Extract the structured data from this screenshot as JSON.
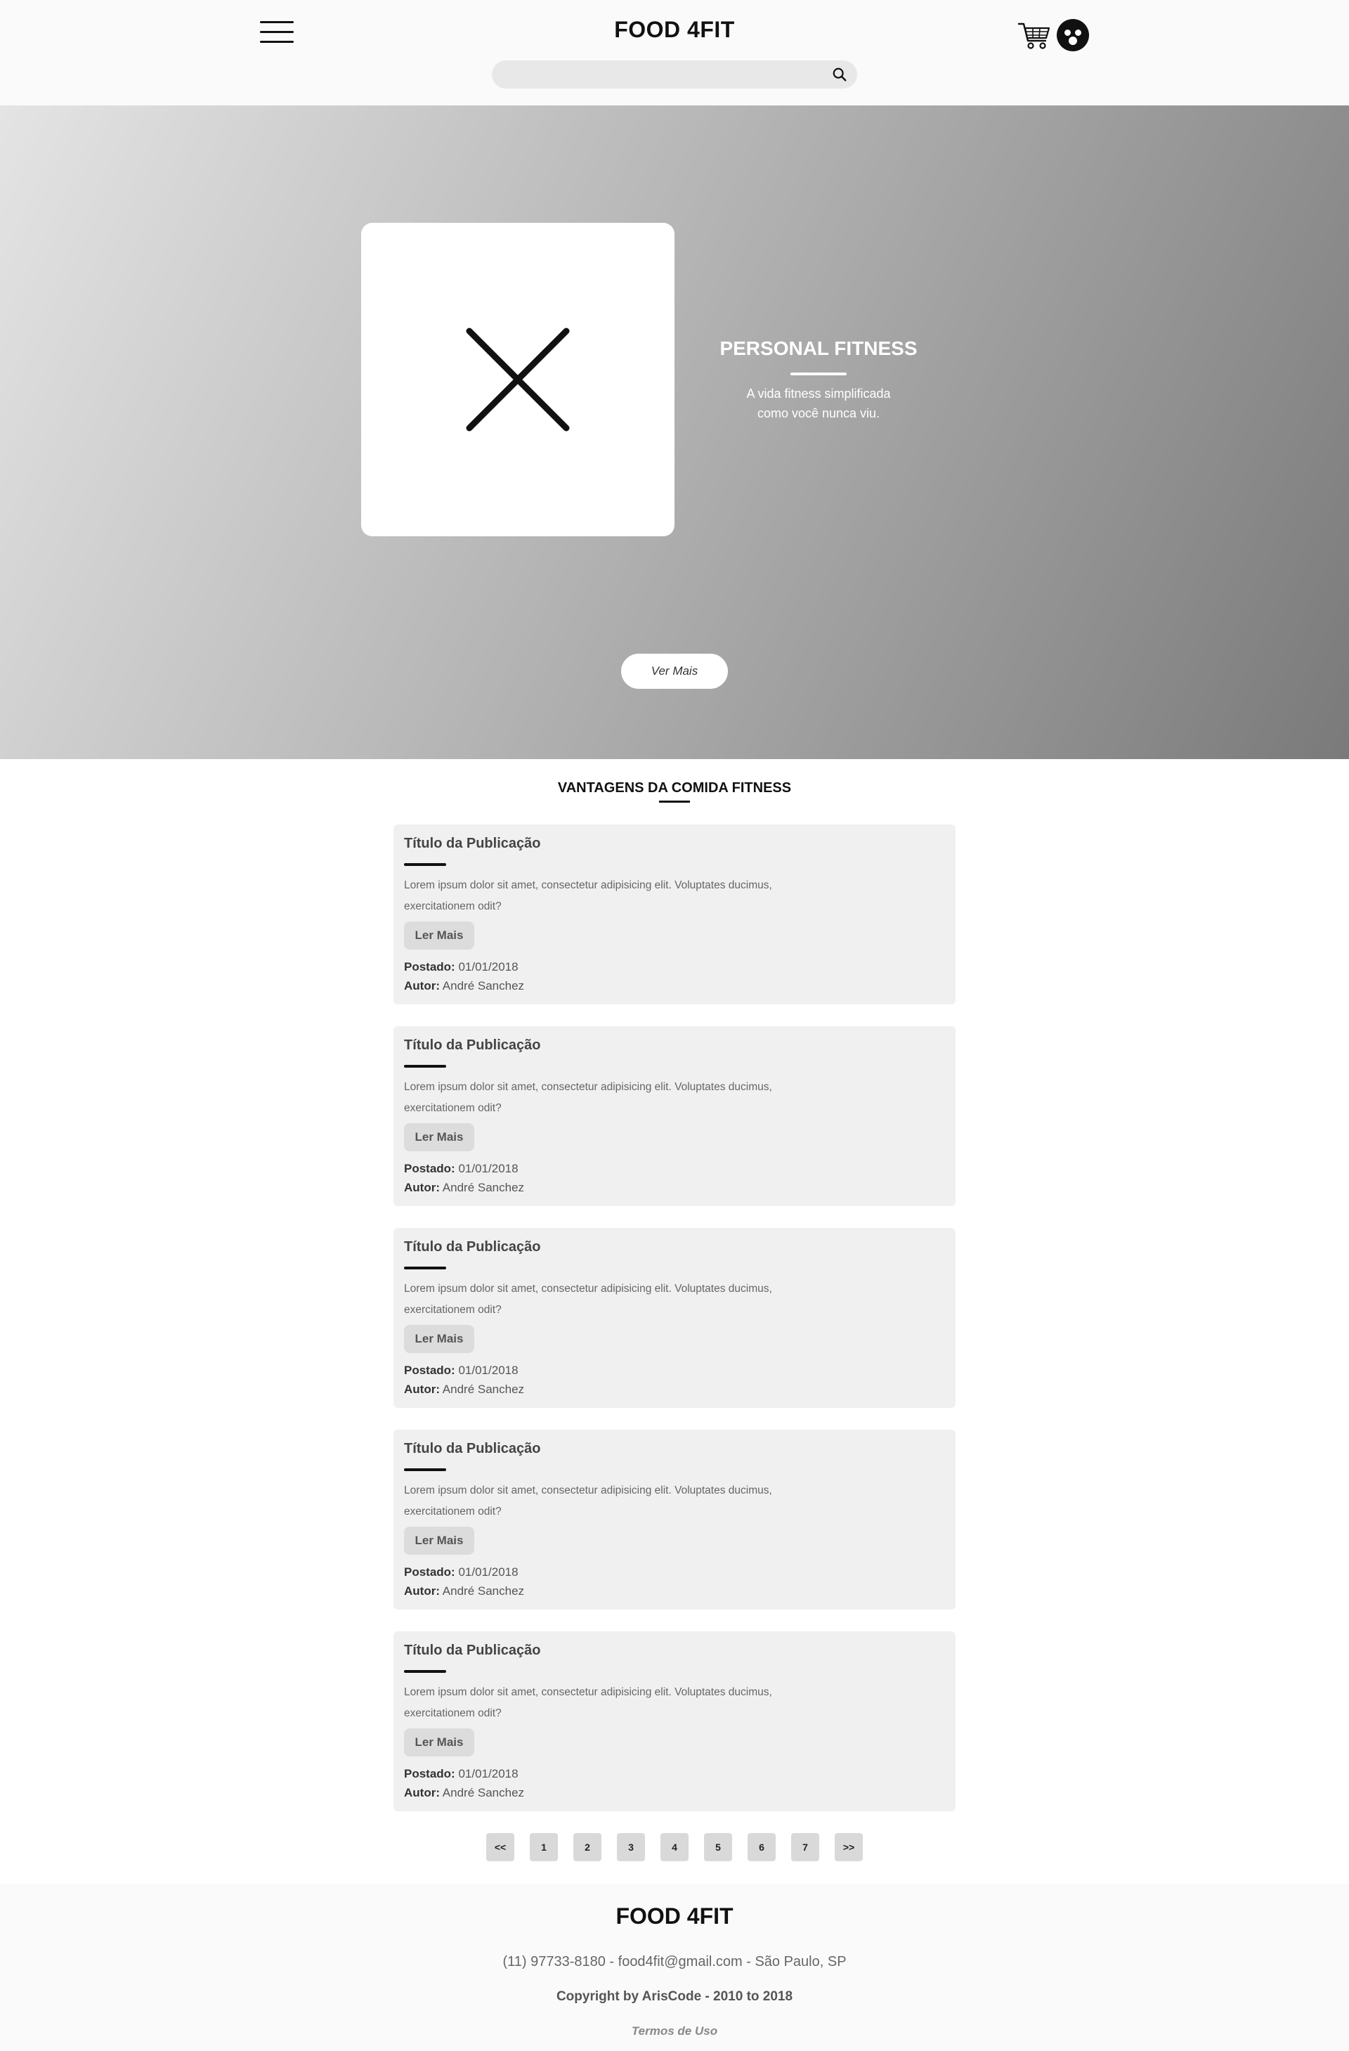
{
  "header": {
    "logo": "FOOD 4FIT",
    "search": {
      "value": "",
      "placeholder": ""
    },
    "icons": {
      "menu": "menu-icon",
      "search": "search-icon",
      "cart": "cart-icon",
      "avatar": "avatar-icon"
    }
  },
  "hero": {
    "title": "PERSONAL FITNESS",
    "subtitle_line1": "A vida fitness simplificada",
    "subtitle_line2": "como você nunca viu.",
    "button_label": "Ver Mais",
    "image_icon": "image-placeholder-icon"
  },
  "section": {
    "title": "VANTAGENS DA COMIDA FITNESS"
  },
  "posts": [
    {
      "title": "Título da Publicação",
      "text_line1": "Lorem ipsum dolor sit amet, consectetur adipisicing elit. Voluptates ducimus,",
      "text_line2": "exercitationem odit?",
      "button_label": "Ler Mais",
      "posted_label": "Postado:",
      "posted_value": "01/01/2018",
      "author_label": "Autor:",
      "author_value": "André Sanchez"
    },
    {
      "title": "Título da Publicação",
      "text_line1": "Lorem ipsum dolor sit amet, consectetur adipisicing elit. Voluptates ducimus,",
      "text_line2": "exercitationem odit?",
      "button_label": "Ler Mais",
      "posted_label": "Postado:",
      "posted_value": "01/01/2018",
      "author_label": "Autor:",
      "author_value": "André Sanchez"
    },
    {
      "title": "Título da Publicação",
      "text_line1": "Lorem ipsum dolor sit amet, consectetur adipisicing elit. Voluptates ducimus,",
      "text_line2": "exercitationem odit?",
      "button_label": "Ler Mais",
      "posted_label": "Postado:",
      "posted_value": "01/01/2018",
      "author_label": "Autor:",
      "author_value": "André Sanchez"
    },
    {
      "title": "Título da Publicação",
      "text_line1": "Lorem ipsum dolor sit amet, consectetur adipisicing elit. Voluptates ducimus,",
      "text_line2": "exercitationem odit?",
      "button_label": "Ler Mais",
      "posted_label": "Postado:",
      "posted_value": "01/01/2018",
      "author_label": "Autor:",
      "author_value": "André Sanchez"
    },
    {
      "title": "Título da Publicação",
      "text_line1": "Lorem ipsum dolor sit amet, consectetur adipisicing elit. Voluptates ducimus,",
      "text_line2": "exercitationem odit?",
      "button_label": "Ler Mais",
      "posted_label": "Postado:",
      "posted_value": "01/01/2018",
      "author_label": "Autor:",
      "author_value": "André Sanchez"
    }
  ],
  "pagination": [
    "<<",
    "1",
    "2",
    "3",
    "4",
    "5",
    "6",
    "7",
    ">>"
  ],
  "footer": {
    "logo": "FOOD 4FIT",
    "contact": "(11) 97733-8180 - food4fit@gmail.com - São Paulo, SP",
    "copyright": "Copyright by ArisCode - 2010 to 2018",
    "terms": "Termos de Uso"
  },
  "colors": {
    "accent": "#111111",
    "hero_gradient_start": "#e4e4e4",
    "hero_gradient_end": "#7a7a7a",
    "card_bg": "#f0f0f0",
    "footer_bg": "#fafafa"
  }
}
